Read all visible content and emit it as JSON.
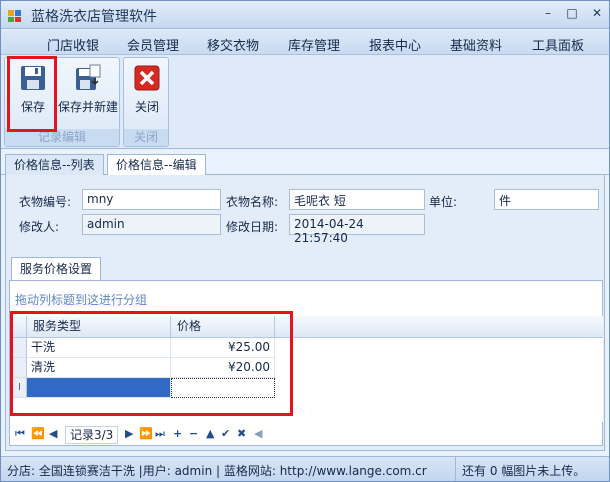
{
  "window": {
    "title": "蓝格洗衣店管理软件"
  },
  "menu": [
    "门店收银",
    "会员管理",
    "移交衣物",
    "库存管理",
    "报表中心",
    "基础资料",
    "工具面板"
  ],
  "ribbon": {
    "group1": {
      "label": "记录编辑",
      "save": "保存",
      "save_new": "保存并新建"
    },
    "group2": {
      "label": "关闭",
      "close": "关闭"
    }
  },
  "tabs": [
    "价格信息--列表",
    "价格信息--编辑"
  ],
  "form": {
    "code_label": "衣物编号:",
    "code_value": "mny",
    "name_label": "衣物名称:",
    "name_value": "毛呢衣 短",
    "unit_label": "单位:",
    "unit_value": "件",
    "editor_label": "修改人:",
    "editor_value": "admin",
    "date_label": "修改日期:",
    "date_value": "2014-04-24  21:57:40"
  },
  "subtab": "服务价格设置",
  "grid": {
    "group_hint": "拖动列标题到这进行分组",
    "columns": [
      "服务类型",
      "价格"
    ],
    "rows": [
      {
        "type": "干洗",
        "price": "¥25.00"
      },
      {
        "type": "清洗",
        "price": "¥20.00"
      }
    ],
    "new_row_marker": "I"
  },
  "navigator": {
    "record_text": "记录3/3"
  },
  "status": {
    "left": "分店: 全国连锁赛洁干洗 |用户: admin | 蓝格网站: http://www.lange.com.cr",
    "right": "还有 0 幅图片未上传。"
  },
  "colors": {
    "highlight_red": "#e3141b",
    "selection_blue": "#316ac5"
  }
}
